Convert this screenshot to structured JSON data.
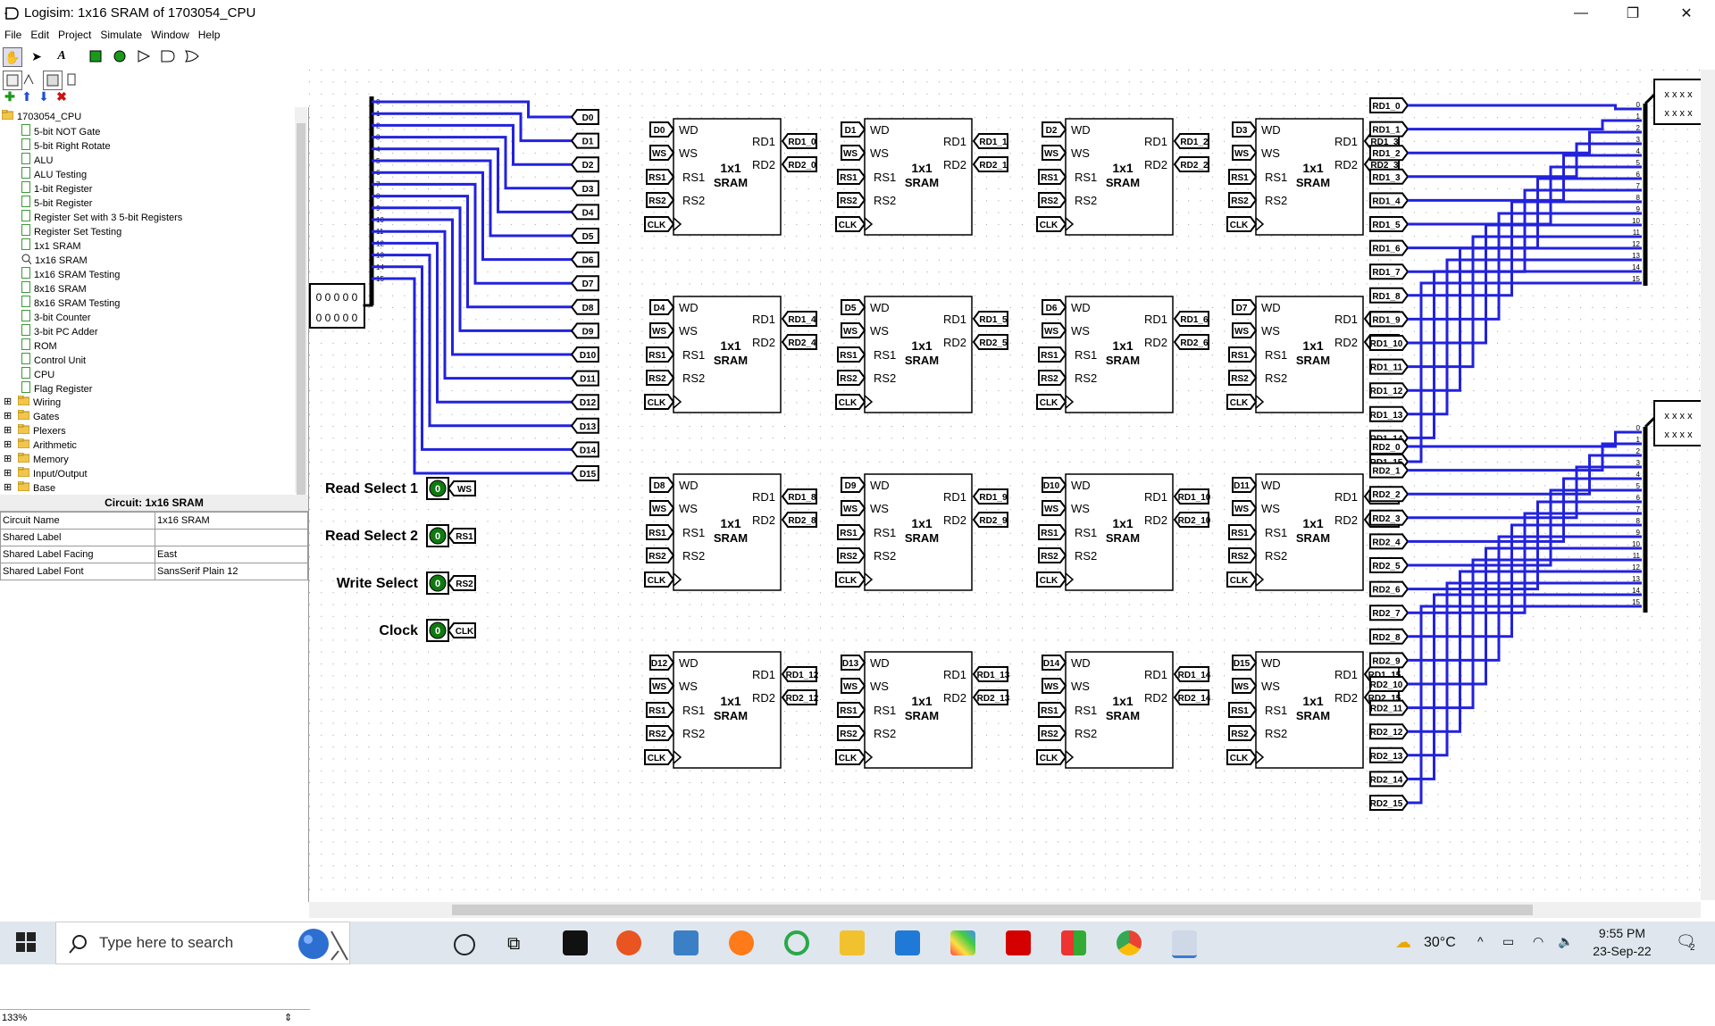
{
  "window": {
    "title": "Logisim: 1x16 SRAM of 1703054_CPU",
    "minimize": "—",
    "restore": "❐",
    "close": "✕"
  },
  "menu": [
    "File",
    "Edit",
    "Project",
    "Simulate",
    "Window",
    "Help"
  ],
  "tree": {
    "root": "1703054_CPU",
    "circuits": [
      "5-bit NOT Gate",
      "5-bit Right Rotate",
      "ALU",
      "ALU Testing",
      "1-bit Register",
      "5-bit Register",
      "Register Set with 3  5-bit Registers",
      "Register Set Testing",
      "1x1 SRAM",
      "1x16 SRAM",
      "1x16 SRAM Testing",
      "8x16 SRAM",
      "8x16 SRAM Testing",
      "3-bit Counter",
      "3-bit PC Adder",
      "ROM",
      "Control Unit",
      "CPU",
      "Flag Register"
    ],
    "libraries": [
      "Wiring",
      "Gates",
      "Plexers",
      "Arithmetic",
      "Memory",
      "Input/Output",
      "Base"
    ]
  },
  "properties": {
    "header": "Circuit: 1x16 SRAM",
    "rows": [
      {
        "key": "Circuit Name",
        "value": "1x16 SRAM"
      },
      {
        "key": "Shared Label",
        "value": ""
      },
      {
        "key": "Shared Label Facing",
        "value": "East"
      },
      {
        "key": "Shared Label Font",
        "value": "SansSerif Plain 12"
      }
    ]
  },
  "zoom": "133%",
  "circuit": {
    "input_value": [
      "0 0 0 0 0",
      "0 0 0 0 0"
    ],
    "xxx_value": [
      "x x x x",
      "x x x x"
    ],
    "data_tunnels": [
      "D0",
      "D1",
      "D2",
      "D3",
      "D4",
      "D5",
      "D6",
      "D7",
      "D8",
      "D9",
      "D10",
      "D11",
      "D12",
      "D13",
      "D14",
      "D15"
    ],
    "bit_indices": [
      "0",
      "1",
      "2",
      "3",
      "4",
      "5",
      "6",
      "7",
      "8",
      "9",
      "10",
      "11",
      "12",
      "13",
      "14",
      "15"
    ],
    "controls": [
      {
        "label": "Read Select 1",
        "value": "0",
        "tunnel": "WS"
      },
      {
        "label": "Read Select 2",
        "value": "0",
        "tunnel": "RS1"
      },
      {
        "label": "Write Select",
        "value": "0",
        "tunnel": "RS2"
      },
      {
        "label": "Clock",
        "value": "0",
        "tunnel": "CLK"
      }
    ],
    "sram_block": {
      "pins_left": [
        "WD",
        "WS",
        "RS1",
        "RS2"
      ],
      "pins_right": [
        "RD1",
        "RD2"
      ],
      "name_line1": "1x1",
      "name_line2": "SRAM",
      "ws": "WS",
      "rs1": "RS1",
      "rs2": "RS2",
      "clk": "CLK"
    },
    "rd1_tunnels": [
      "RD1_0",
      "RD1_1",
      "RD1_2",
      "RD1_3",
      "RD1_4",
      "RD1_5",
      "RD1_6",
      "RD1_7",
      "RD1_8",
      "RD1_9",
      "RD1_10",
      "RD1_11",
      "RD1_12",
      "RD1_13",
      "RD1_14",
      "RD1_15"
    ],
    "rd2_tunnels": [
      "RD2_0",
      "RD2_1",
      "RD2_2",
      "RD2_3",
      "RD2_4",
      "RD2_5",
      "RD2_6",
      "RD2_7",
      "RD2_8",
      "RD2_9",
      "RD2_10",
      "RD2_11",
      "RD2_12",
      "RD2_13",
      "RD2_14",
      "RD2_15"
    ]
  },
  "taskbar": {
    "search_placeholder": "Type here to search",
    "weather": "30°C",
    "time": "9:55 PM",
    "date": "23-Sep-22",
    "notifications": "2"
  },
  "colors": {
    "wire": "#2222dd",
    "pin_green": "#0f7a0f",
    "accent_input": "#0a8a0a"
  }
}
